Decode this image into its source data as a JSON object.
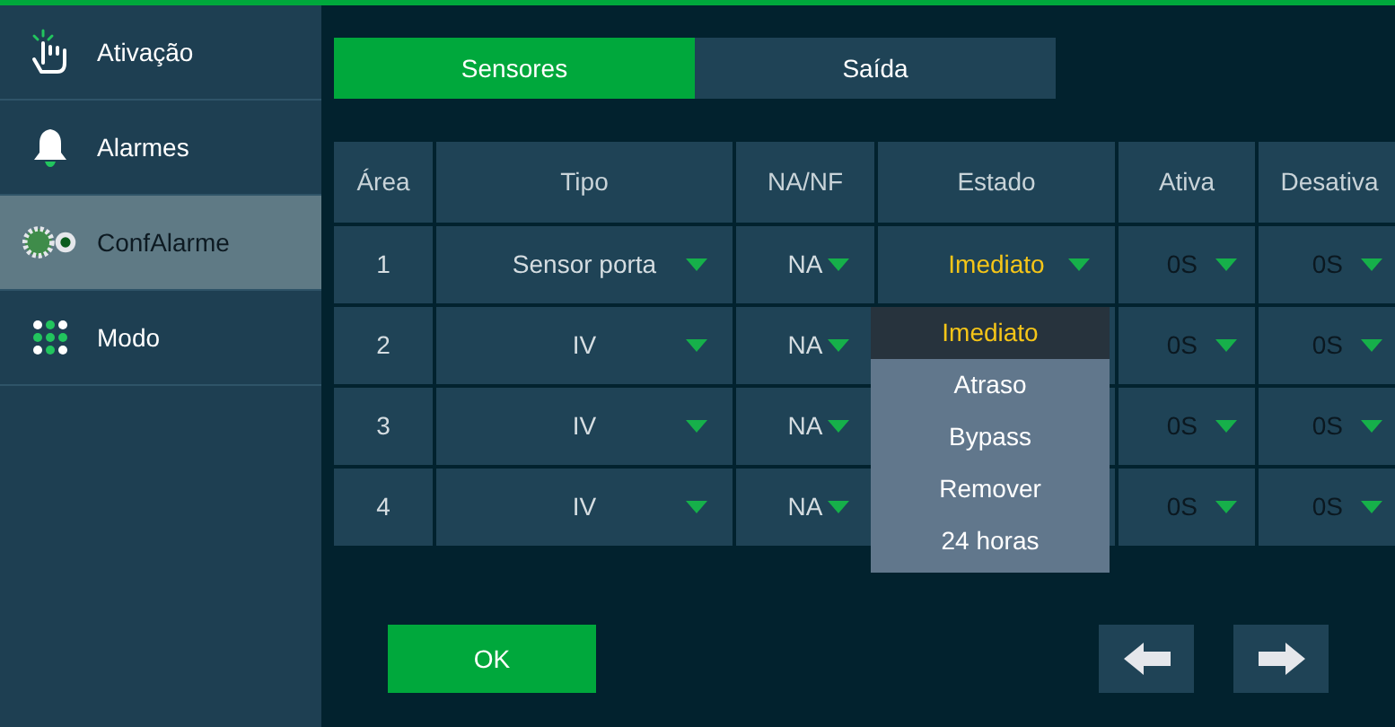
{
  "sidebar": {
    "items": [
      {
        "label": "Ativação",
        "kind": "hand",
        "selected": false
      },
      {
        "label": "Alarmes",
        "kind": "bell",
        "selected": false
      },
      {
        "label": "ConfAlarme",
        "kind": "gears",
        "selected": true
      },
      {
        "label": "Modo",
        "kind": "dots",
        "selected": false
      }
    ]
  },
  "tabs": [
    {
      "label": "Sensores",
      "selected": true
    },
    {
      "label": "Saída",
      "selected": false
    }
  ],
  "table": {
    "columns": [
      "Área",
      "Tipo",
      "NA/NF",
      "Estado",
      "Ativa",
      "Desativa"
    ],
    "rows": [
      {
        "area": "1",
        "tipo": "Sensor porta",
        "na_nf": "NA",
        "estado": "Imediato",
        "ativa": "0S",
        "desativa": "0S"
      },
      {
        "area": "2",
        "tipo": "IV",
        "na_nf": "NA",
        "ativa": "0S",
        "desativa": "0S"
      },
      {
        "area": "3",
        "tipo": "IV",
        "na_nf": "NA",
        "ativa": "0S",
        "desativa": "0S"
      },
      {
        "area": "4",
        "tipo": "IV",
        "na_nf": "NA",
        "ativa": "0S",
        "desativa": "0S"
      }
    ]
  },
  "estado_dropdown": {
    "options": [
      {
        "label": "Imediato",
        "selected": true
      },
      {
        "label": "Atraso",
        "selected": false
      },
      {
        "label": "Bypass",
        "selected": false
      },
      {
        "label": "Remover",
        "selected": false
      },
      {
        "label": "24 horas",
        "selected": false
      }
    ]
  },
  "ok_button": "OK"
}
